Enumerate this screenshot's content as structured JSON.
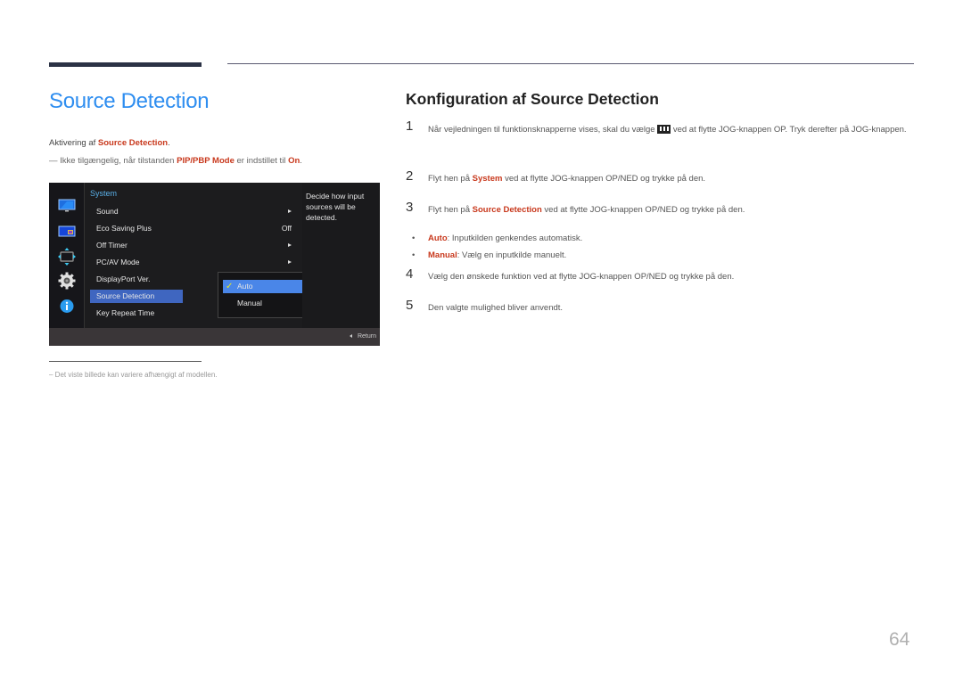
{
  "left": {
    "title": "Source Detection",
    "intro_prefix": "Aktivering af ",
    "intro_highlight": "Source Detection",
    "intro_suffix": ".",
    "note_dash": "―",
    "note_prefix": " Ikke tilgængelig, når tilstanden ",
    "note_highlight1": "PIP/PBP Mode",
    "note_middle": " er indstillet til ",
    "note_highlight2": "On",
    "note_suffix": ".",
    "footnote": "–  Det viste billede kan variere afhængigt af modellen."
  },
  "osd": {
    "icons": [
      "picture-icon",
      "pip-icon",
      "resize-icon",
      "system-gear-icon",
      "info-icon"
    ],
    "category": "System",
    "items": [
      {
        "label": "Sound",
        "value": "",
        "arrow": true
      },
      {
        "label": "Eco Saving Plus",
        "value": "Off",
        "arrow": false
      },
      {
        "label": "Off Timer",
        "value": "",
        "arrow": true
      },
      {
        "label": "PC/AV Mode",
        "value": "",
        "arrow": true
      },
      {
        "label": "DisplayPort Ver.",
        "value": "",
        "arrow": false
      },
      {
        "label": "Source Detection",
        "value": "",
        "arrow": false,
        "selected": true
      },
      {
        "label": "Key Repeat Time",
        "value": "",
        "arrow": false
      }
    ],
    "submenu": [
      {
        "label": "Auto",
        "selected": true,
        "check": "✓"
      },
      {
        "label": "Manual",
        "selected": false
      }
    ],
    "help_text": "Decide how input sources will be detected.",
    "return_label": "Return"
  },
  "right": {
    "title": "Konfiguration af Source Detection",
    "steps": [
      {
        "num": "1",
        "text_prefix": "Når vejledningen til funktionsknapperne vises, skal du vælge ",
        "text_suffix": " ved at flytte JOG-knappen OP. Tryk derefter på JOG-knappen."
      },
      {
        "num": "2",
        "text_prefix": "Flyt hen på ",
        "highlight": "System",
        "text_suffix": " ved at flytte JOG-knappen OP/NED og trykke på den."
      },
      {
        "num": "3",
        "text_prefix": "Flyt hen på ",
        "highlight": "Source Detection",
        "text_suffix": " ved at flytte JOG-knappen OP/NED og trykke på den."
      },
      {
        "num": "4",
        "text": "Vælg den ønskede funktion ved at flytte JOG-knappen OP/NED og trykke på den."
      },
      {
        "num": "5",
        "text": "Den valgte mulighed bliver anvendt."
      }
    ],
    "bullets": [
      {
        "dot": "•",
        "highlight": "Auto",
        "text": ": Inputkilden genkendes automatisk."
      },
      {
        "dot": "•",
        "highlight": "Manual",
        "text": ": Vælg en inputkilde manuelt."
      }
    ]
  },
  "page_number": "64"
}
